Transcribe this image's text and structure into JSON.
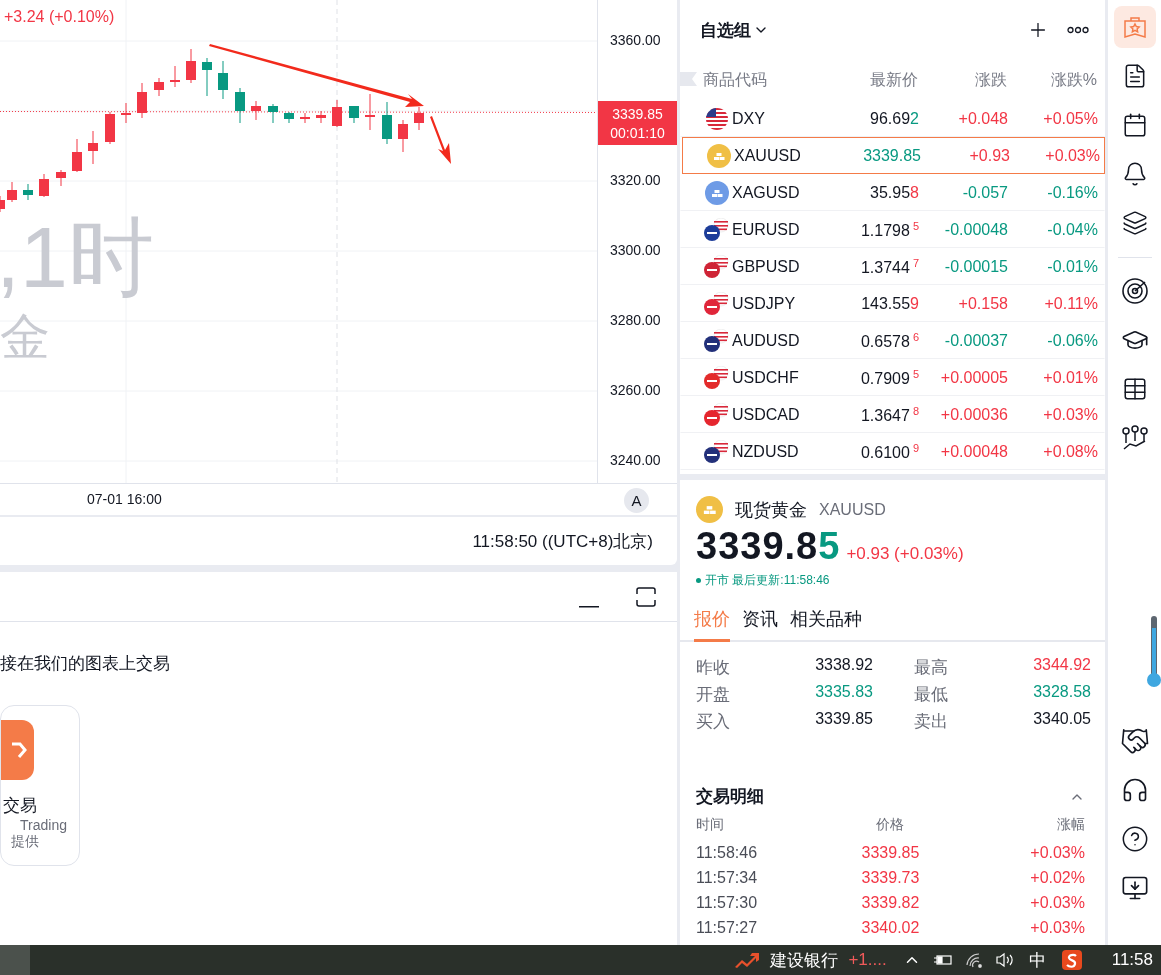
{
  "chart": {
    "change": "+3.24 (+0.10%)",
    "watermark": [
      ",1时",
      "金"
    ],
    "price_ticks": [
      "3360.00",
      "3320.00",
      "3300.00",
      "3280.00",
      "3260.00",
      "3240.00"
    ],
    "last_price": "3339.85",
    "countdown": "00:01:10",
    "time_label": "07-01 16:00",
    "scale_button": "A"
  },
  "clock": "11:58:50 ((UTC+8)北京)",
  "panel": {
    "promo": "接在我们的图表上交易",
    "card": {
      "title": "交易",
      "line1": "Trading",
      "line2": "提供"
    }
  },
  "watchlist": {
    "title": "自选组",
    "columns": [
      "商品代码",
      "最新价",
      "涨跌",
      "涨跌%"
    ],
    "rows": [
      {
        "symbol": "DXY",
        "kind": "index",
        "price": "96.69",
        "digit": "2",
        "raised": false,
        "digit_up": false,
        "tinted": false,
        "change": "+0.048",
        "pct": "+0.05%",
        "up": true,
        "selected": false
      },
      {
        "symbol": "XAUUSD",
        "kind": "metal",
        "color": "#f0bf45",
        "price": "3339.8",
        "digit": "5",
        "raised": false,
        "digit_up": false,
        "tinted": true,
        "change": "+0.93",
        "pct": "+0.03%",
        "up": true,
        "selected": true
      },
      {
        "symbol": "XAGUSD",
        "kind": "metal",
        "color": "#6e9be6",
        "price": "35.95",
        "digit": "8",
        "raised": false,
        "digit_up": true,
        "tinted": false,
        "change": "-0.057",
        "pct": "-0.16%",
        "up": false,
        "selected": false
      },
      {
        "symbol": "EURUSD",
        "kind": "pair",
        "color": "#1d3d99",
        "price": "1.1798",
        "digit": "5",
        "raised": true,
        "digit_up": true,
        "tinted": false,
        "change": "-0.00048",
        "pct": "-0.04%",
        "up": false,
        "selected": false
      },
      {
        "symbol": "GBPUSD",
        "kind": "pair",
        "color": "#cf2436",
        "price": "1.3744",
        "digit": "7",
        "raised": true,
        "digit_up": true,
        "tinted": false,
        "change": "-0.00015",
        "pct": "-0.01%",
        "up": false,
        "selected": false
      },
      {
        "symbol": "USDJPY",
        "kind": "pair",
        "color": "#e0263a",
        "price": "143.55",
        "digit": "9",
        "raised": false,
        "digit_up": true,
        "tinted": false,
        "change": "+0.158",
        "pct": "+0.11%",
        "up": true,
        "selected": false
      },
      {
        "symbol": "AUDUSD",
        "kind": "pair",
        "color": "#22307a",
        "price": "0.6578",
        "digit": "6",
        "raised": true,
        "digit_up": true,
        "tinted": false,
        "change": "-0.00037",
        "pct": "-0.06%",
        "up": false,
        "selected": false
      },
      {
        "symbol": "USDCHF",
        "kind": "pair",
        "color": "#e32b2b",
        "price": "0.7909",
        "digit": "5",
        "raised": true,
        "digit_up": true,
        "tinted": false,
        "change": "+0.00005",
        "pct": "+0.01%",
        "up": true,
        "selected": false
      },
      {
        "symbol": "USDCAD",
        "kind": "pair",
        "color": "#e5262e",
        "price": "1.3647",
        "digit": "8",
        "raised": true,
        "digit_up": true,
        "tinted": false,
        "change": "+0.00036",
        "pct": "+0.03%",
        "up": true,
        "selected": false
      },
      {
        "symbol": "NZDUSD",
        "kind": "pair",
        "color": "#23307a",
        "price": "0.6100",
        "digit": "9",
        "raised": true,
        "digit_up": true,
        "tinted": false,
        "change": "+0.00048",
        "pct": "+0.08%",
        "up": true,
        "selected": false
      }
    ]
  },
  "quote": {
    "name": "现货黄金",
    "symbol": "XAUUSD",
    "price": "3339.8",
    "digit": "5",
    "change": "+0.93 (+0.03%)",
    "status": "开市 最后更新:11:58:46",
    "tabs": [
      {
        "label": "报价",
        "selected": true
      },
      {
        "label": "资讯",
        "selected": false
      },
      {
        "label": "相关品种",
        "selected": false
      }
    ],
    "stats": [
      {
        "label": "昨收",
        "value": "3338.92",
        "up": false,
        "down": false
      },
      {
        "label": "最高",
        "value": "3344.92",
        "up": true,
        "down": false
      },
      {
        "label": "开盘",
        "value": "3335.83",
        "up": false,
        "down": true
      },
      {
        "label": "最低",
        "value": "3328.58",
        "up": false,
        "down": true
      },
      {
        "label": "买入",
        "value": "3339.85",
        "up": false,
        "down": false
      },
      {
        "label": "卖出",
        "value": "3340.05",
        "up": false,
        "down": false
      }
    ],
    "trades": {
      "title": "交易明细",
      "columns": [
        "时间",
        "价格",
        "涨幅"
      ],
      "rows": [
        {
          "time": "11:58:46",
          "price": "3339.85",
          "pct": "+0.03%",
          "up": true
        },
        {
          "time": "11:57:34",
          "price": "3339.73",
          "pct": "+0.02%",
          "up": true
        },
        {
          "time": "11:57:30",
          "price": "3339.82",
          "pct": "+0.03%",
          "up": true
        },
        {
          "time": "11:57:27",
          "price": "3340.02",
          "pct": "+0.03%",
          "up": true
        }
      ]
    }
  },
  "sidebar_items": [
    {
      "selected": true
    },
    {
      "selected": false
    },
    {
      "selected": false
    },
    {
      "selected": false
    },
    {
      "selected": false
    },
    {
      "selected": false
    },
    {
      "selected": false
    },
    {
      "selected": false
    },
    {
      "selected": false
    },
    {
      "selected": false
    },
    {
      "selected": false
    },
    {
      "selected": false
    },
    {
      "selected": false
    }
  ],
  "taskbar": {
    "stock": "建设银行",
    "stock_change": "+1....",
    "ime": "中",
    "time": "11:58"
  }
}
